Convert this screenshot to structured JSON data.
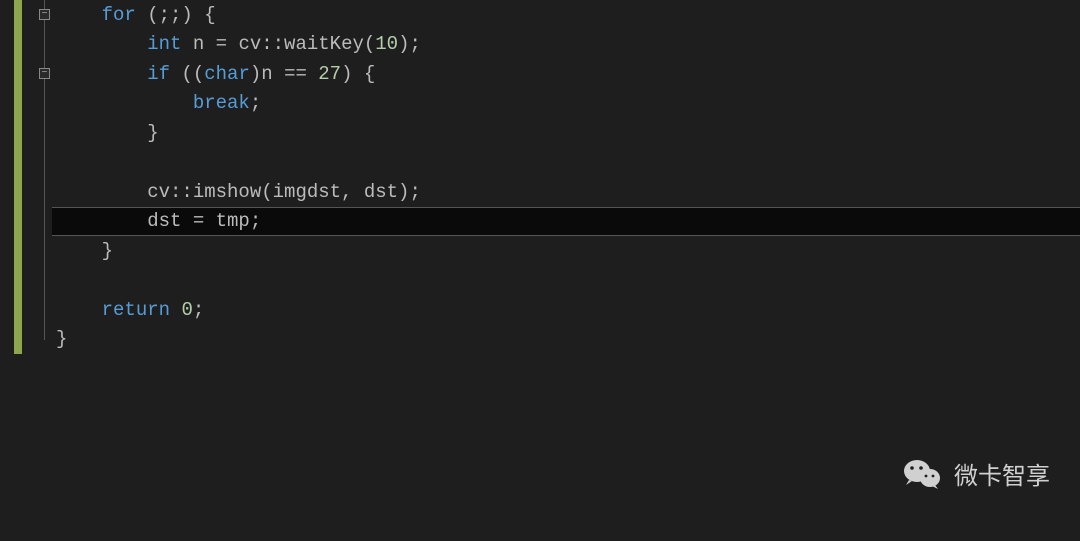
{
  "code": {
    "line1_for": "for",
    "line1_rest": " (;;) {",
    "line2_int": "int",
    "line2_rest1": " n = cv::waitKey(",
    "line2_num": "10",
    "line2_rest2": ");",
    "line3_if": "if",
    "line3_rest1": " ((",
    "line3_char": "char",
    "line3_rest2": ")n == ",
    "line3_num": "27",
    "line3_rest3": ") {",
    "line4_break": "break",
    "line4_semi": ";",
    "line5_brace": "}",
    "line7_cv": "cv::imshow(imgdst, dst);",
    "line8_dst": "dst = tmp;",
    "line9_brace": "}",
    "line11_return": "return",
    "line11_sp": " ",
    "line11_num": "0",
    "line11_semi": ";",
    "line12_brace": "}"
  },
  "watermark_text": "微卡智享",
  "fold_minus": "−"
}
